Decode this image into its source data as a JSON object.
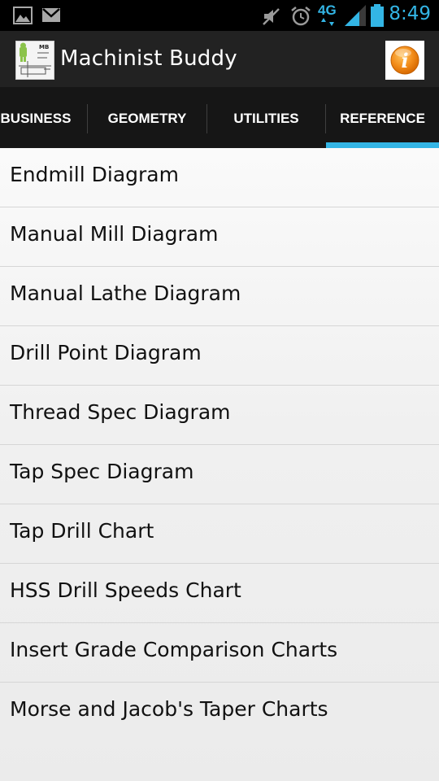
{
  "status_bar": {
    "time": "8:49",
    "network_label": "4G",
    "icons": [
      "gallery-icon",
      "gmail-icon",
      "mute-icon",
      "alarm-icon",
      "4g-lte-icon",
      "signal-icon",
      "battery-icon"
    ]
  },
  "action_bar": {
    "title": "Machinist Buddy",
    "logo_text": "MB",
    "info_glyph": "i"
  },
  "tabs": [
    {
      "label": "BUSINESS",
      "selected": false
    },
    {
      "label": "GEOMETRY",
      "selected": false
    },
    {
      "label": "UTILITIES",
      "selected": false
    },
    {
      "label": "REFERENCE",
      "selected": true
    }
  ],
  "list": {
    "items": [
      {
        "label": "Endmill Diagram"
      },
      {
        "label": "Manual Mill Diagram"
      },
      {
        "label": "Manual Lathe Diagram"
      },
      {
        "label": "Drill Point Diagram"
      },
      {
        "label": "Thread Spec Diagram"
      },
      {
        "label": "Tap Spec Diagram"
      },
      {
        "label": "Tap Drill Chart"
      },
      {
        "label": "HSS Drill Speeds Chart"
      },
      {
        "label": "Insert Grade Comparison Charts"
      },
      {
        "label": "Morse and Jacob's Taper Charts"
      }
    ]
  },
  "colors": {
    "accent": "#33b5e5",
    "action_bar": "#222222",
    "tab_bar": "#161616",
    "info_orange": "#f28c1a"
  }
}
